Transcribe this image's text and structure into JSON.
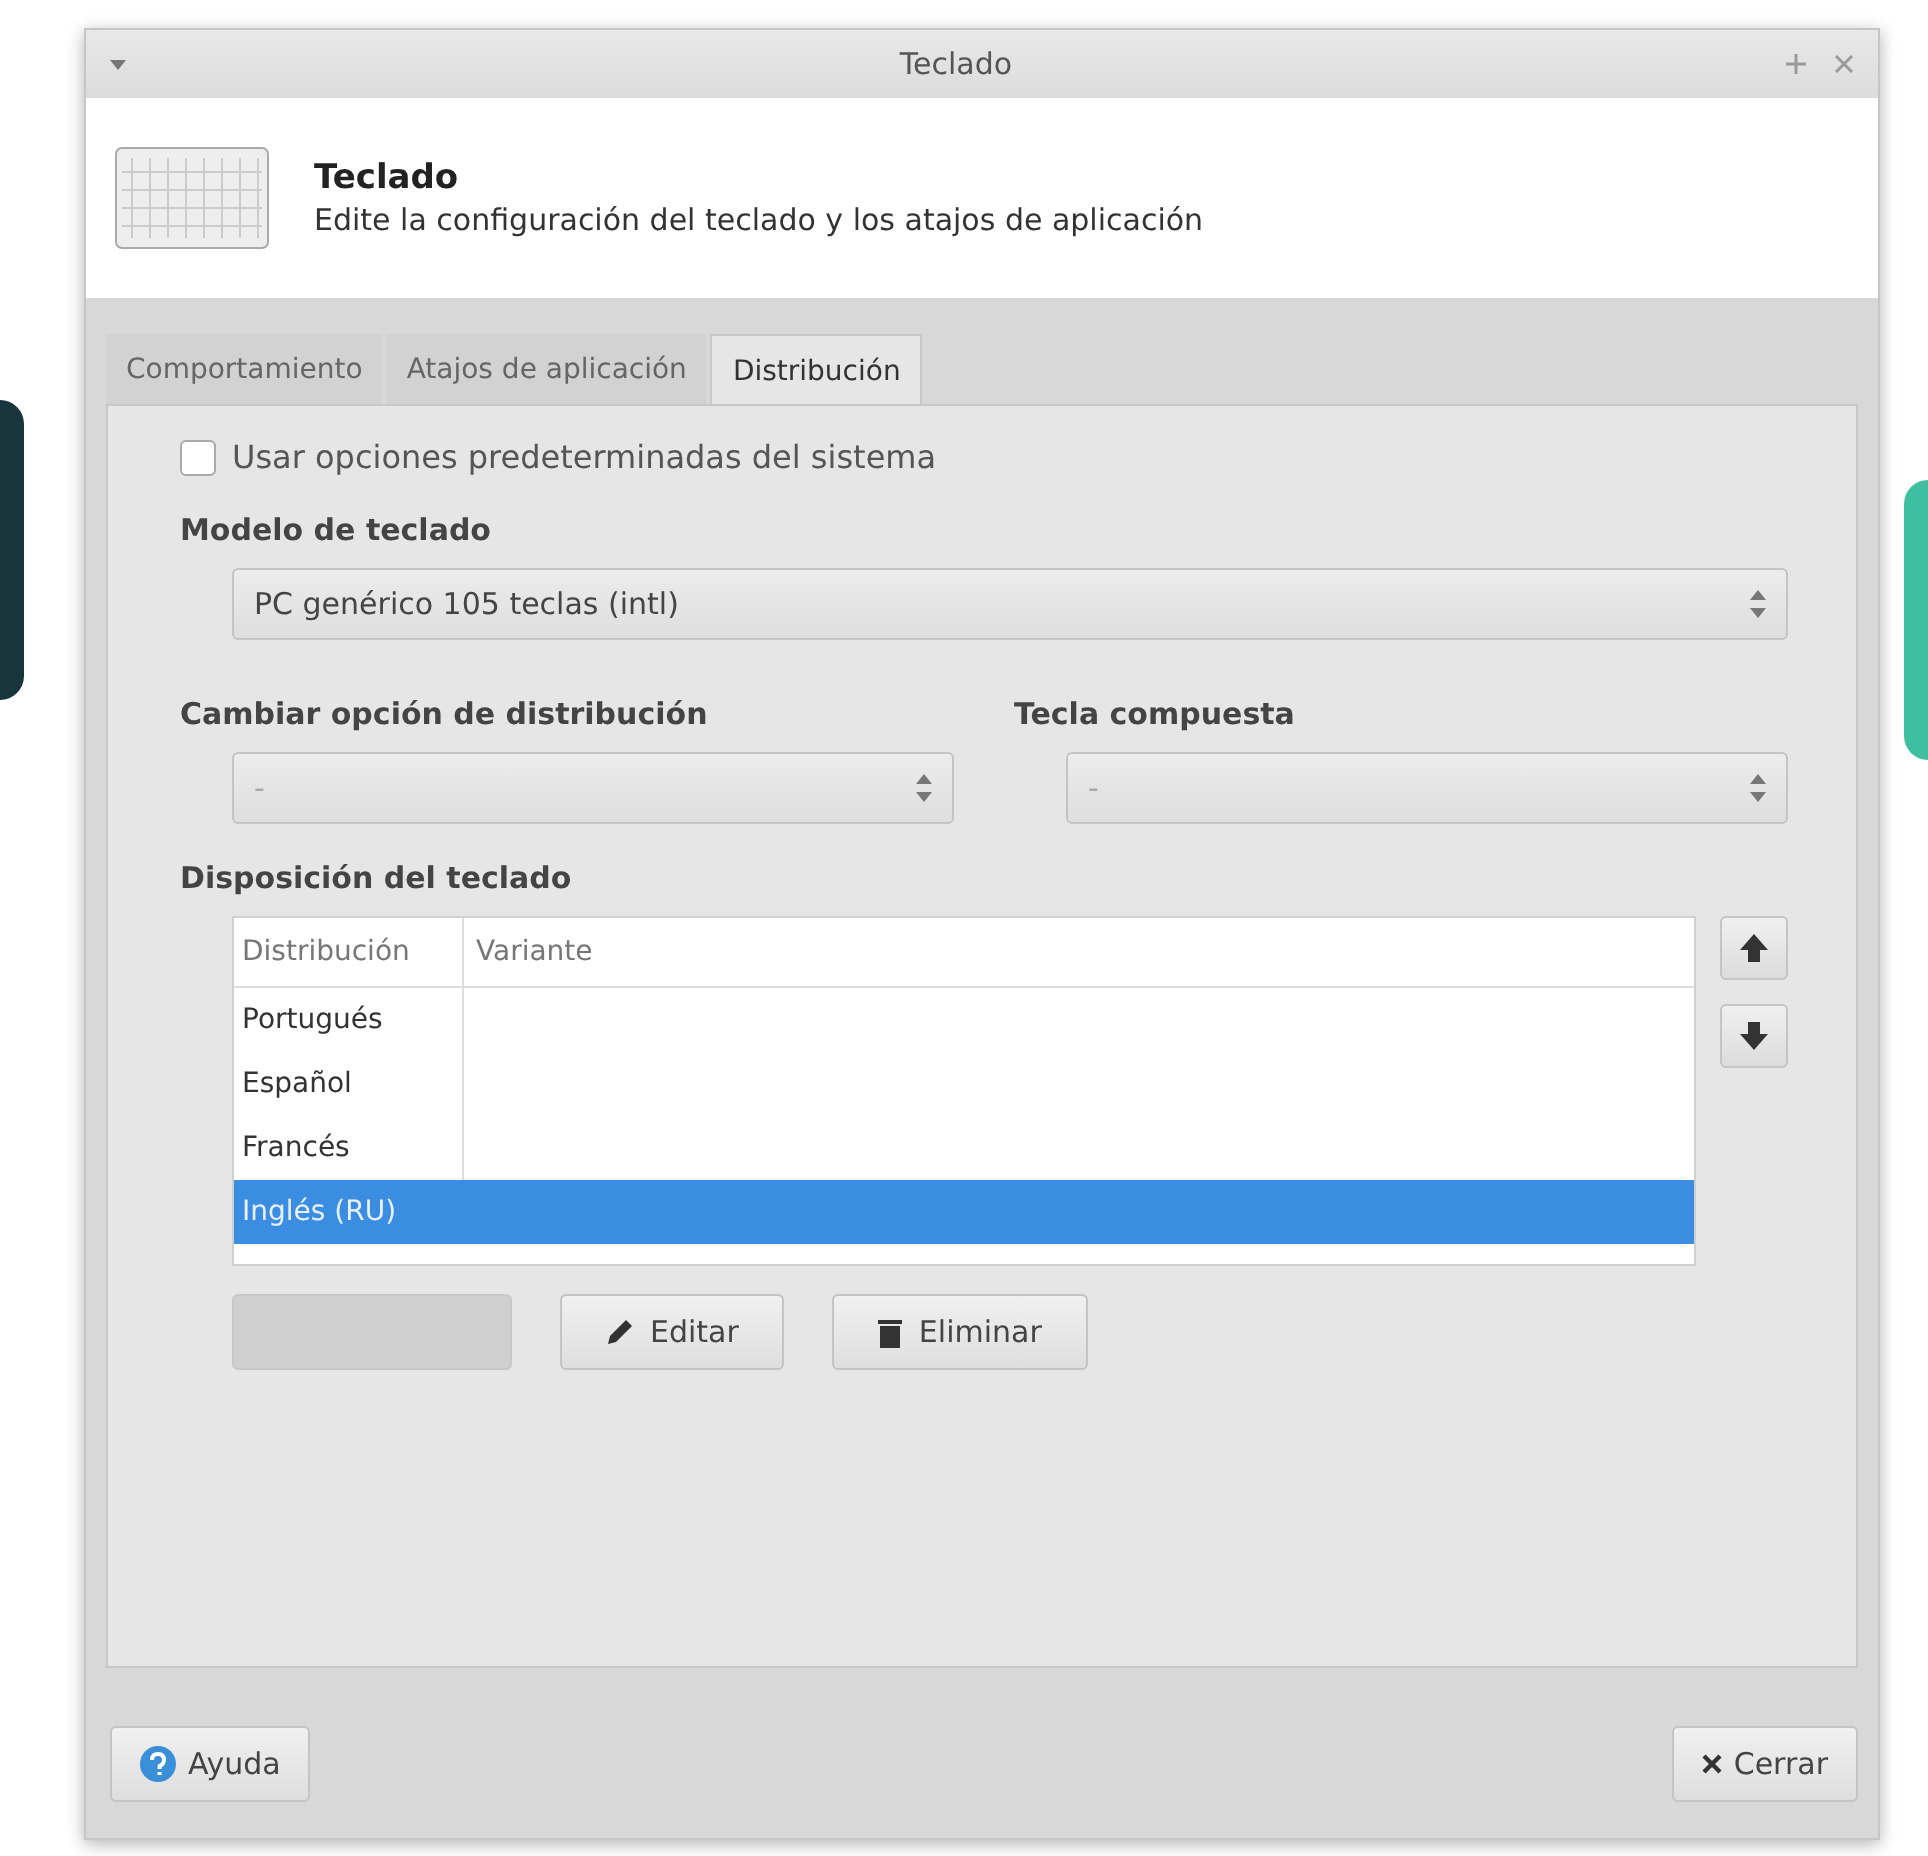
{
  "window": {
    "title": "Teclado"
  },
  "header": {
    "title": "Teclado",
    "subtitle": "Edite la configuración del teclado y los atajos de aplicación"
  },
  "tabs": [
    {
      "label": "Comportamiento",
      "selected": false
    },
    {
      "label": "Atajos de aplicación",
      "selected": false
    },
    {
      "label": "Distribución",
      "selected": true
    }
  ],
  "use_system_defaults": {
    "label": "Usar opciones predeterminadas del sistema",
    "checked": false
  },
  "keyboard_model": {
    "label": "Modelo de teclado",
    "value": "PC genérico 105 teclas (intl)"
  },
  "switch_option": {
    "label": "Cambiar opción de distribución",
    "value": "-"
  },
  "compose_key": {
    "label": "Tecla compuesta",
    "value": "-"
  },
  "layouts": {
    "label": "Disposición del teclado",
    "columns": [
      "Distribución",
      "Variante"
    ],
    "rows": [
      {
        "layout": "Portugués",
        "selected": false
      },
      {
        "layout": "Español",
        "selected": false
      },
      {
        "layout": "Francés",
        "selected": false
      },
      {
        "layout": "Inglés (RU)",
        "selected": true
      }
    ]
  },
  "layout_buttons": [
    {
      "kind": "add",
      "disabled": true
    },
    {
      "kind": "edit",
      "label": "Editar",
      "disabled": false
    },
    {
      "kind": "delete",
      "label": "Eliminar",
      "disabled": false
    }
  ],
  "footer_buttons": [
    {
      "kind": "help",
      "label": "Ayuda"
    },
    {
      "kind": "close",
      "label": "Cerrar"
    }
  ]
}
